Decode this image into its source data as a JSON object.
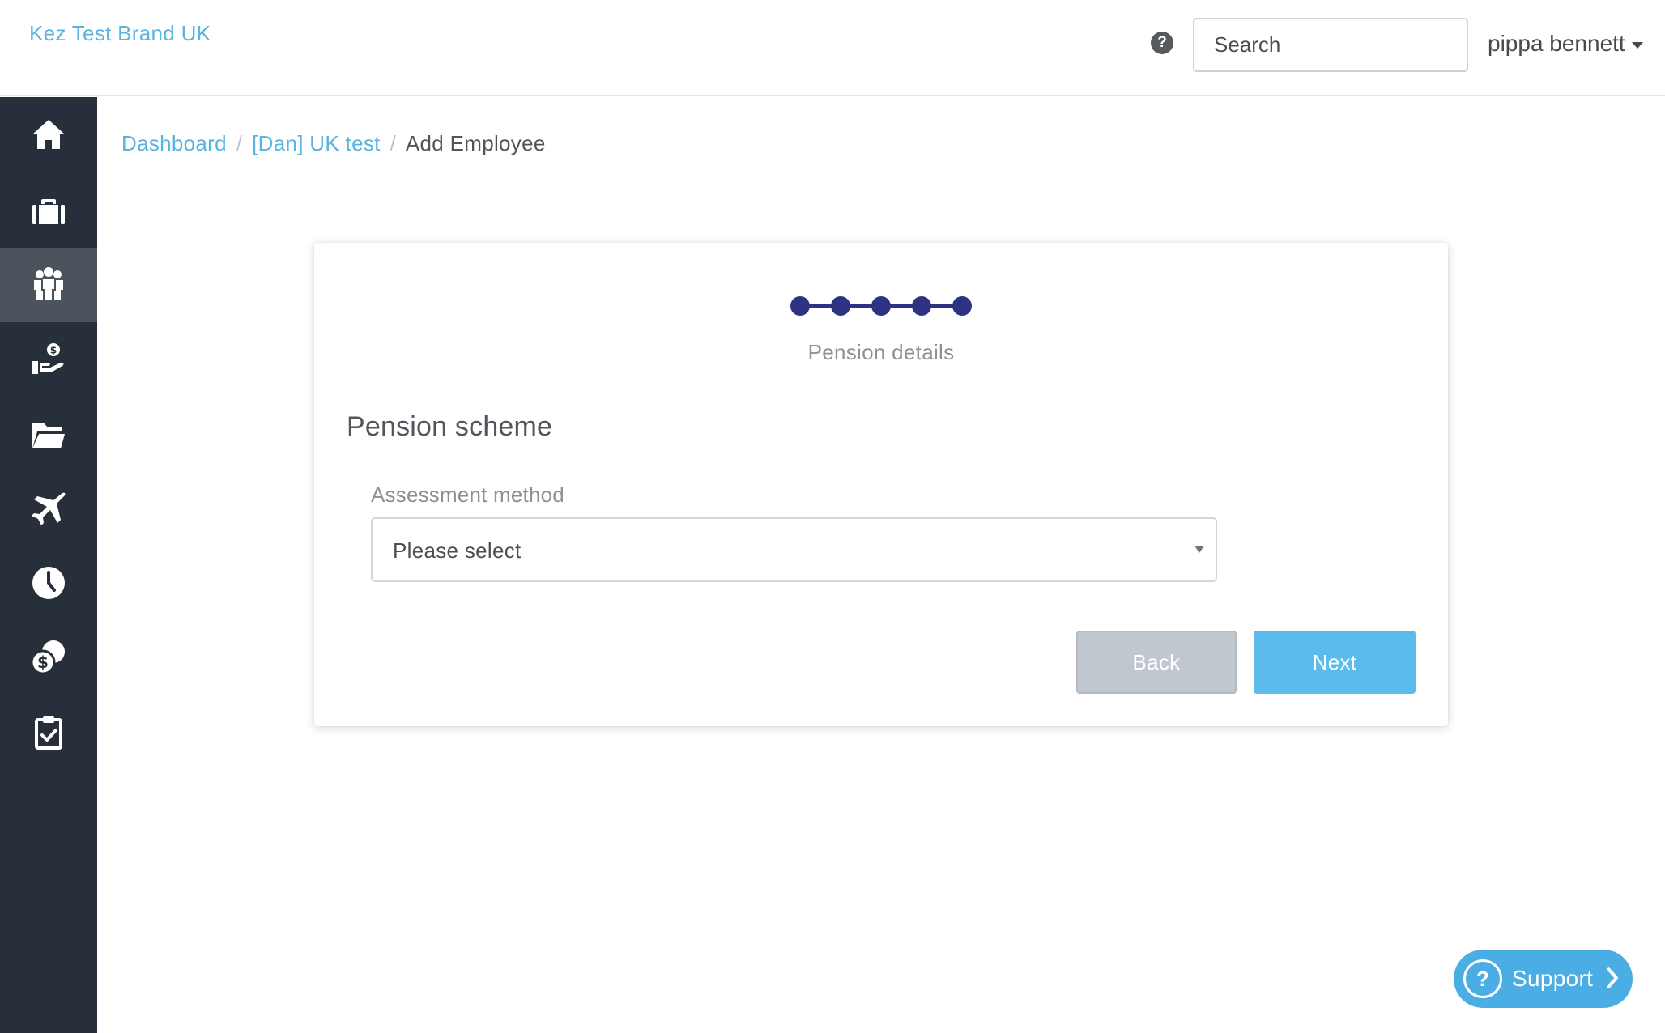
{
  "header": {
    "brand": "Kez Test Brand UK",
    "help_icon": "question-icon",
    "search_placeholder": "Search",
    "user_name": "pippa bennett"
  },
  "sidebar": {
    "items": [
      {
        "icon": "home-icon",
        "active": false
      },
      {
        "icon": "briefcase-icon",
        "active": false
      },
      {
        "icon": "people-icon",
        "active": true
      },
      {
        "icon": "money-hand-icon",
        "active": false
      },
      {
        "icon": "folder-icon",
        "active": false
      },
      {
        "icon": "plane-icon",
        "active": false
      },
      {
        "icon": "clock-icon",
        "active": false
      },
      {
        "icon": "coins-icon",
        "active": false
      },
      {
        "icon": "clipboard-check-icon",
        "active": false
      }
    ]
  },
  "breadcrumb": {
    "items": [
      "Dashboard",
      "[Dan] UK test"
    ],
    "current": "Add Employee"
  },
  "wizard": {
    "total_steps": 5,
    "step_label": "Pension details",
    "section_title": "Pension scheme",
    "field_label": "Assessment method",
    "select_value": "Please select",
    "back_label": "Back",
    "next_label": "Next"
  },
  "support": {
    "label": "Support",
    "icon": "question-icon"
  },
  "colors": {
    "brand_link": "#5ab4e0",
    "sidebar_bg": "#27303a",
    "sidebar_active": "#4b535c",
    "stepper": "#2d3382",
    "next_button": "#5bbbeb",
    "back_button": "#c1c7cf",
    "support_bg": "#4aaee4"
  }
}
